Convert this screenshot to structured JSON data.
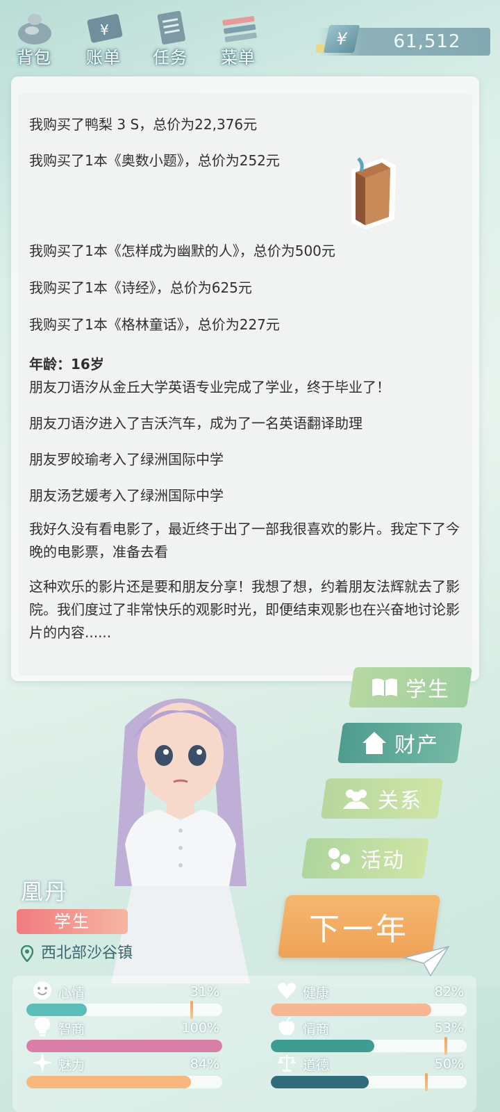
{
  "topbar": {
    "buttons": [
      {
        "label": "背包",
        "icon": "bag-icon"
      },
      {
        "label": "账单",
        "icon": "bill-icon"
      },
      {
        "label": "任务",
        "icon": "task-icon"
      },
      {
        "label": "菜单",
        "icon": "menu-icon"
      }
    ],
    "money_symbol": "¥",
    "money_value": "61,512"
  },
  "log": {
    "purchases": [
      "我购买了鸭梨 3 S，总价为22,376元",
      "我购买了1本《奥数小题》，总价为252元",
      "我购买了1本《怎样成为幽默的人》，总价为500元",
      "我购买了1本《诗经》，总价为625元",
      "我购买了1本《格林童话》，总价为227元"
    ],
    "age_label": "年龄：16岁",
    "events": [
      "朋友刀语汐从金丘大学英语专业完成了学业，终于毕业了！",
      "朋友刀语汐进入了吉沃汽车，成为了一名英语翻译助理",
      "朋友罗皎瑜考入了绿洲国际中学",
      "朋友汤艺媛考入了绿洲国际中学",
      "我好久没有看电影了，最近终于出了一部我很喜欢的影片。我定下了今晚的电影票，准备去看",
      "这种欢乐的影片还是要和朋友分享！我想了想，约着朋友法辉就去了影院。我们度过了非常快乐的观影时光，即便结束观影也在兴奋地讨论影片的内容......"
    ]
  },
  "character": {
    "name": "凰丹",
    "role": "学生",
    "location": "西北部沙谷镇"
  },
  "nav": {
    "student": "学生",
    "assets": "财产",
    "relation": "关系",
    "activity": "活动",
    "next_year": "下一年"
  },
  "stats": [
    {
      "label": "心情",
      "value": "31%",
      "fraction": 0.31,
      "color": "#5bbdb8",
      "icon": "smile-icon"
    },
    {
      "label": "健康",
      "value": "82%",
      "fraction": 0.82,
      "color": "#f7b792",
      "icon": "heart-icon"
    },
    {
      "label": "智商",
      "value": "100%",
      "fraction": 1.0,
      "color": "#d97fa7",
      "icon": "bulb-icon"
    },
    {
      "label": "情商",
      "value": "53%",
      "fraction": 0.53,
      "color": "#3e9d93",
      "icon": "apple-icon"
    },
    {
      "label": "魅力",
      "value": "84%",
      "fraction": 0.84,
      "color": "#f8b87d",
      "icon": "sparkle-icon"
    },
    {
      "label": "道德",
      "value": "50%",
      "fraction": 0.5,
      "color": "#2f6b7b",
      "icon": "scale-icon"
    }
  ]
}
